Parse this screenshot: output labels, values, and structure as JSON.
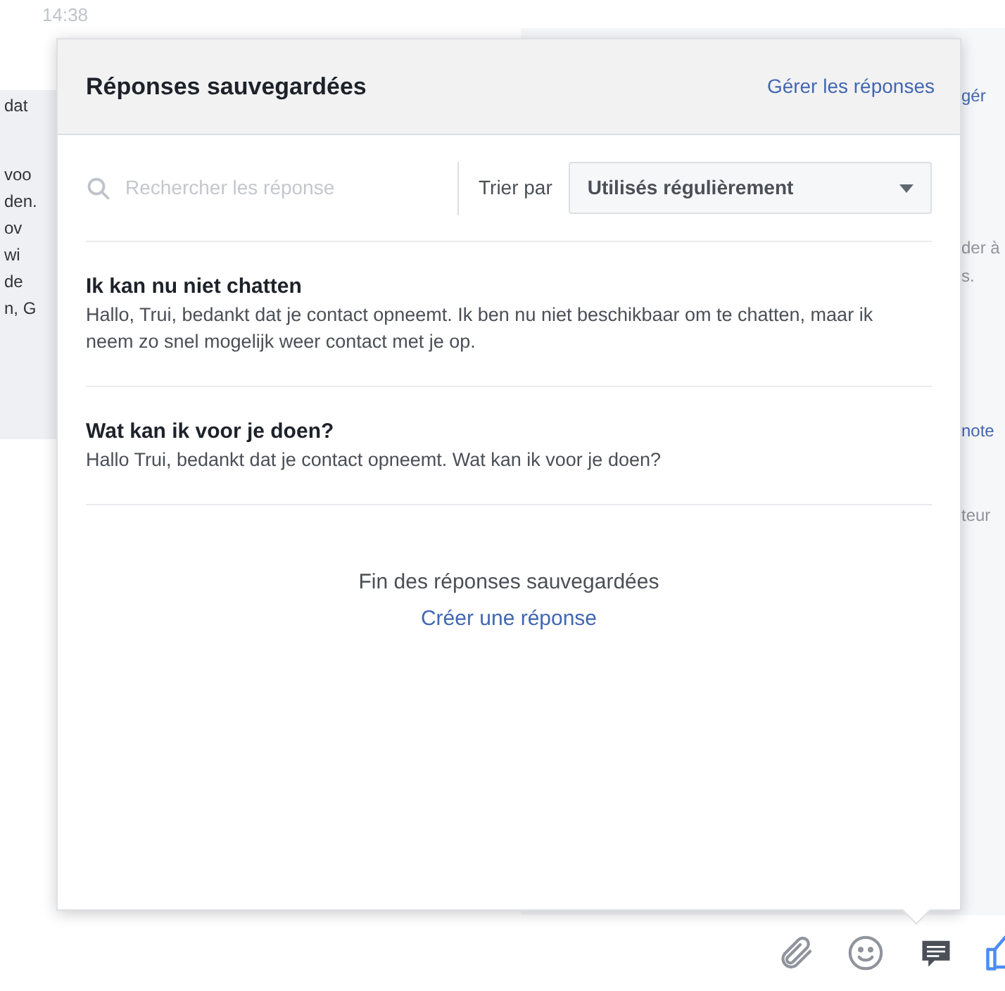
{
  "background": {
    "time": "14:38",
    "left_fragments": [
      {
        "text": "dat"
      },
      {
        "text": "voo"
      },
      {
        "text": "den."
      },
      {
        "text": "ov"
      },
      {
        "text": "wi"
      },
      {
        "text": "de"
      },
      {
        "text": "n, G"
      }
    ],
    "right_fragments": [
      {
        "text": "gér",
        "kind": "link"
      },
      {
        "text": "der à",
        "kind": "text"
      },
      {
        "text": "s.",
        "kind": "text"
      },
      {
        "text": "note",
        "kind": "link"
      },
      {
        "text": "teur",
        "kind": "text"
      }
    ]
  },
  "popup": {
    "title": "Réponses sauvegardées",
    "manage_link": "Gérer les réponses",
    "search": {
      "placeholder": "Rechercher les réponse"
    },
    "sort": {
      "label": "Trier par",
      "value": "Utilisés régulièrement"
    },
    "responses": [
      {
        "title": "Ik kan nu niet chatten",
        "body": "Hallo, Trui, bedankt dat je contact opneemt. Ik ben nu niet beschikbaar om te chatten, maar ik neem zo snel mogelijk weer contact met je op."
      },
      {
        "title": "Wat kan ik voor je doen?",
        "body": "Hallo Trui, bedankt dat je contact opneemt. Wat kan ik voor je doen?"
      }
    ],
    "end_text": "Fin des réponses sauvegardées",
    "create_link": "Créer une réponse"
  },
  "toolbar": [
    {
      "kind": "attach",
      "selected": false
    },
    {
      "kind": "emoji",
      "selected": false
    },
    {
      "kind": "saved",
      "selected": true
    },
    {
      "kind": "like"
    }
  ]
}
